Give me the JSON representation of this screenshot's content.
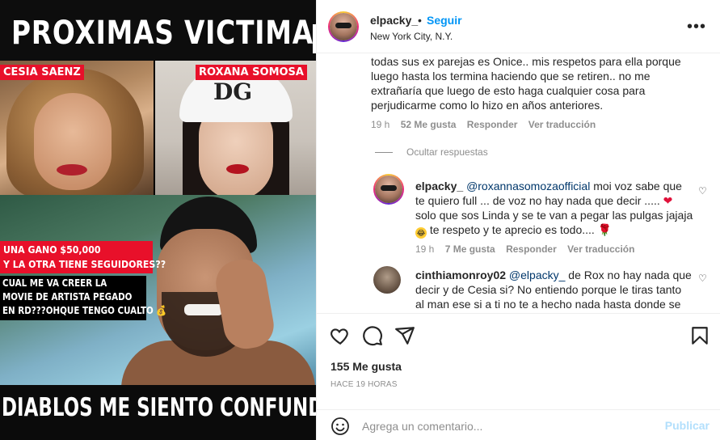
{
  "post_image": {
    "title": "PROXIMAS VICTIMAS",
    "name_left": "CESIA SAENZ",
    "name_right": "ROXANA SOMOSA",
    "cap_logo": "DG",
    "red_line1": "UNA GANO $50,000",
    "red_line2": "Y LA OTRA TIENE SEGUIDORES??",
    "black_line1": "CUAL ME VA CREER LA",
    "black_line2": "MOVIE DE ARTISTA PEGADO",
    "black_line3": "EN RD???OHQUE TENGO CUALTO",
    "money_emoji": "💰",
    "bottom_caption": "DIABLOS ME SIENTO CONFUNDIDO"
  },
  "header": {
    "username": "elpacky_",
    "dot": "•",
    "follow": "Seguir",
    "location": "New York City, N.Y.",
    "more": "•••"
  },
  "comments": {
    "c1": {
      "lines": [
        "todas sus ex parejas es Onice.. mis respetos para ella porque",
        "luego hasta los termina haciendo que se retiren.. no me",
        "extrañaría que luego de esto haga cualquier cosa para",
        "perjudicarme como lo hizo en años anteriores."
      ],
      "time": "19 h",
      "likes": "52 Me gusta",
      "reply": "Responder",
      "translate": "Ver traducción"
    },
    "hide_replies": "Ocultar respuestas",
    "c2": {
      "username": "elpacky_",
      "mention": "@roxannasomozaofficial",
      "line1_rest": " moi voz sabe que",
      "line2": "te quiero full ... de voz no hay nada que decir .....",
      "line3": "solo que sos Linda y se te van a pegar las pulgas jajaja",
      "line4": " te respeto y te aprecio es todo....",
      "heart_emoji": "❤",
      "laugh_emoji": "😂",
      "rose_emoji": "🌹",
      "time": "19 h",
      "likes": "7 Me gusta",
      "reply": "Responder",
      "translate": "Ver traducción"
    },
    "c3": {
      "username": "cinthiamonroy02",
      "mention": "@elpacky_",
      "line1_rest": " de Rox no hay nada que",
      "line2": "decir y de Cesia si? No entiendo porque le tiras tanto",
      "line3": "al man ese si a ti no te a hecho nada hasta donde se"
    }
  },
  "actions": {
    "likes": "155 Me gusta",
    "time": "HACE 19 HORAS"
  },
  "composer": {
    "placeholder": "Agrega un comentario...",
    "publish": "Publicar"
  },
  "colors": {
    "accent_blue": "#0095f6",
    "publish_disabled": "#b2dffc",
    "meta_grey": "#8e8e8e",
    "tag_red": "#e8102a"
  }
}
